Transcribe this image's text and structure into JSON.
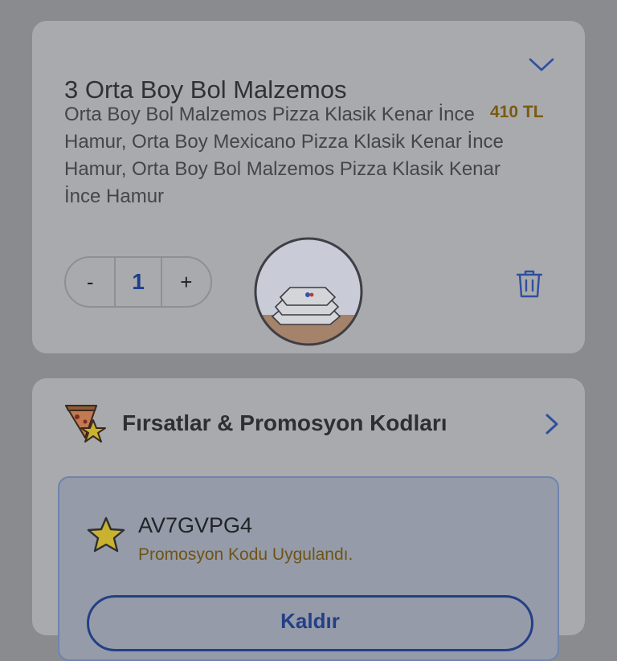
{
  "order": {
    "title": "3 Orta Boy Bol Malzemos",
    "description": "Orta Boy Bol Malzemos Pizza Klasik Kenar İnce Hamur, Orta Boy Mexicano Pizza Klasik Kenar İnce Hamur, Orta Boy Bol Malzemos Pizza Klasik Kenar İnce Hamur",
    "price": "410 TL",
    "quantity": "1",
    "minus_label": "-",
    "plus_label": "+"
  },
  "promo": {
    "title": "Fırsatlar & Promosyon Kodları",
    "code": "AV7GVPG4",
    "status": "Promosyon Kodu Uygulandı.",
    "remove_label": "Kaldır"
  },
  "colors": {
    "accent": "#243f86",
    "price": "#7a5b10",
    "promo_status": "#6e5416"
  },
  "icons": [
    "chevron-down-icon",
    "trash-icon",
    "pizza-slice-star-icon",
    "chevron-right-icon",
    "star-icon",
    "pizza-boxes-image"
  ]
}
